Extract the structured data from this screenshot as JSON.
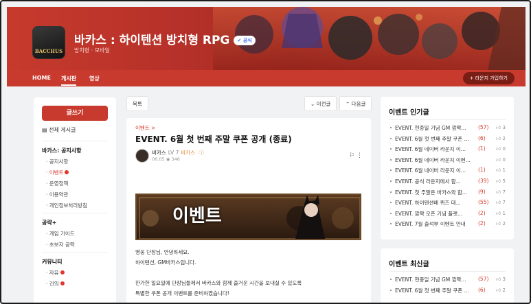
{
  "header": {
    "game_title": "바카스 : 하이텐션 방치형 RPG",
    "official_badge": "공식",
    "subtitle": "방치형 · 모바일",
    "icon_logo": "BACCHUS"
  },
  "nav": {
    "items": [
      "HOME",
      "게시판",
      "영상"
    ],
    "active": "게시판",
    "join_label": "+ 라운지 가입하기"
  },
  "sidebar": {
    "write_label": "글쓰기",
    "all_posts": "전체 게시글",
    "sections": [
      {
        "title": "바카스: 공지사항",
        "items": [
          "공지사항",
          "이벤트",
          "운영정책",
          "이용약관",
          "개인정보처리방침"
        ]
      },
      {
        "title": "공략+",
        "items": [
          "게임 가이드",
          "초보자 공략"
        ]
      },
      {
        "title": "커뮤니티",
        "items": [
          "자유",
          "건의"
        ]
      }
    ]
  },
  "toolbar": {
    "list_label": "목록",
    "prev_label": "이전글",
    "next_label": "다음글"
  },
  "post": {
    "breadcrumb": "이벤트 >",
    "title": "EVENT. 6월 첫 번째 주말 쿠폰 공개 (종료)",
    "author": "바카스",
    "level": "LV 7",
    "role": "바카스",
    "date": "06.05",
    "views": "346",
    "banner_text": "이벤트",
    "body": [
      "영웅 단장님, 안녕하세요.",
      "하이텐션, GM바카스입니다.",
      "",
      "한가한 일요일에 단장님들께서 바카스와 함께 즐거운 시간을 보내실 수 있도록",
      "특별한 쿠폰 공개 이벤트를 준비하였습니다!"
    ]
  },
  "popular": {
    "title": "이벤트 인기글",
    "items": [
      {
        "title": "EVENT. 현중일 기념 GM 깜짝...",
        "count": "(57)",
        "likes": "3"
      },
      {
        "title": "EVENT. 6월 첫 번째 주말 쿠폰 ...",
        "count": "(6)",
        "likes": "2"
      },
      {
        "title": "EVENT. 6월 네이버 라운지 이...",
        "count": "(1)",
        "likes": "0"
      },
      {
        "title": "EVENT. 6월 네이버 라운지 이벤...",
        "count": "",
        "likes": "0"
      },
      {
        "title": "EVENT. 6월 네이버 라운지 이...",
        "count": "(1)",
        "likes": "1"
      },
      {
        "title": "EVENT. 공식 라운지에서 함...",
        "count": "(39)",
        "likes": "5"
      },
      {
        "title": "EVENT. 첫 주말은 바카스와 함...",
        "count": "(9)",
        "likes": "7"
      },
      {
        "title": "EVENT. 하이텐션배 퀴즈 대...",
        "count": "(55)",
        "likes": "7"
      },
      {
        "title": "EVENT. 깜짝 오픈 기념 플랫...",
        "count": "(2)",
        "likes": "1"
      },
      {
        "title": "EVENT. 7월 출석부 이벤트 안내",
        "count": "(2)",
        "likes": "2"
      }
    ]
  },
  "latest": {
    "title": "이벤트 최신글",
    "items": [
      {
        "title": "EVENT. 현중일 기념 GM 깜짝...",
        "count": "(57)",
        "likes": "3"
      },
      {
        "title": "EVENT. 6월 첫 번째 주말 쿠폰 ...",
        "count": "(6)",
        "likes": "2"
      }
    ]
  }
}
